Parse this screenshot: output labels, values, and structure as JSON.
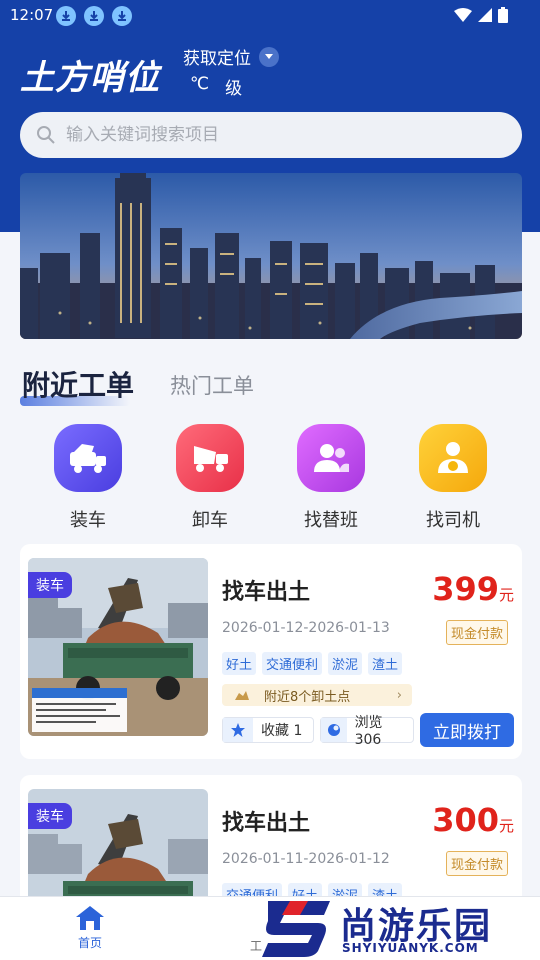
{
  "status_bar": {
    "time": "12:07"
  },
  "header": {
    "logo": "土方哨位",
    "location_label": "获取定位",
    "temperature_unit": "℃",
    "wind_level": "级"
  },
  "search": {
    "placeholder": "输入关键词搜索项目"
  },
  "tabs": {
    "active": "附近工单",
    "inactive": "热门工单"
  },
  "categories": [
    {
      "label": "装车",
      "icon": "loader-truck-icon",
      "color": "#5b4af0"
    },
    {
      "label": "卸车",
      "icon": "dump-truck-icon",
      "color": "#f0465a"
    },
    {
      "label": "找替班",
      "icon": "team-icon",
      "color": "#c94af0"
    },
    {
      "label": "找司机",
      "icon": "driver-icon",
      "color": "#f5b60c"
    }
  ],
  "cards": [
    {
      "badge": "装车",
      "title": "找车出土",
      "price": "399",
      "price_unit": "元",
      "date_range": "2026-01-12-2026-01-13",
      "payment": "现金付款",
      "tags": [
        "好土",
        "交通便利",
        "淤泥",
        "渣土"
      ],
      "nearby": "附近8个卸土点",
      "favorites": "收藏 1",
      "views": "浏览 306",
      "call_label": "立即拨打"
    },
    {
      "badge": "装车",
      "title": "找车出土",
      "price": "300",
      "price_unit": "元",
      "date_range": "2026-01-11-2026-01-12",
      "payment": "现金付款",
      "tags": [
        "交通便利",
        "好土",
        "淤泥",
        "渣土"
      ]
    }
  ],
  "bottom_nav": {
    "home": "首页",
    "second": "工"
  },
  "watermark": {
    "main": "尚游乐园",
    "sub": "SHYIYUANYK.COM"
  },
  "colors": {
    "primary": "#1541a8",
    "accent": "#2f6be3",
    "price": "#e0231b"
  }
}
